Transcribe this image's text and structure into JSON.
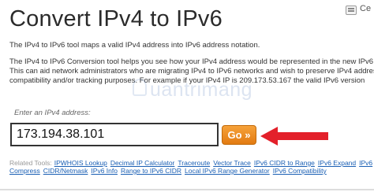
{
  "page": {
    "title": "Convert IPv4 to IPv6",
    "corner_text": "Ce"
  },
  "intro": "The IPv4 to IPv6 tool maps a valid IPv4 address into IPv6 address notation.",
  "description": {
    "lines": [
      "The IPv4 to IPv6 Conversion tool helps you see how your IPv4 address would be represented in the new IPv6 pr",
      "This can aid network administrators who are migrating IPv4 to IPv6 networks and wish to preserve IPv4 address",
      "compatibility and/or tracking purposes. For example if your IPv4 IP is 209.173.53.167 the valid IPv6 version"
    ]
  },
  "watermark": "uantrimang",
  "form": {
    "label": "Enter an IPv4 address:",
    "input_value": "173.194.38.101",
    "go_label": "Go »"
  },
  "related": {
    "label": "Related Tools:",
    "row1": [
      "IPWHOIS Lookup",
      "Decimal IP Calculator",
      "Traceroute",
      "Vector Trace",
      "IPv6 CIDR to Range",
      "IPv6 Expand",
      "IPv6"
    ],
    "row2": [
      "Compress",
      "CIDR/Netmask",
      "IPv6 Info",
      "Range to IPv6 CIDR",
      "Local IPv6 Range Generator",
      "IPv6 Compatibility"
    ]
  },
  "colors": {
    "go_button": "#e88a1e",
    "arrow": "#e3202a",
    "link": "#1a5fb4"
  },
  "icons": {
    "corner": "menu-icon",
    "arrow": "arrow-left-icon"
  }
}
